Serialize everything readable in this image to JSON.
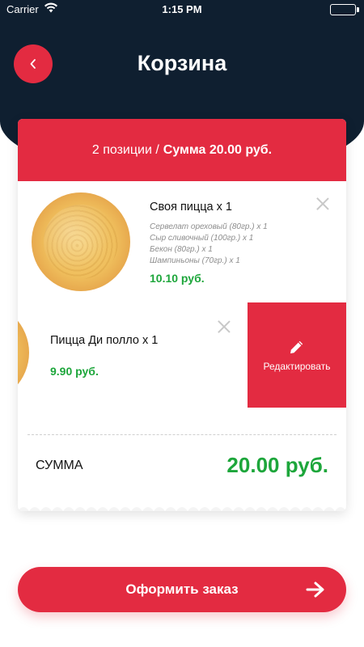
{
  "status_bar": {
    "carrier": "Carrier",
    "time": "1:15 PM",
    "battery_level": 1.0,
    "battery_color": "#2ecc40"
  },
  "header": {
    "title": "Корзина",
    "back_icon": "chevron-left-icon",
    "background_color": "#0f1f30"
  },
  "cart": {
    "summary_count": "2 позиции /",
    "summary_total": "Сумма 20.00 руб.",
    "items": [
      {
        "name": "Своя пицца x 1",
        "ingredients": [
          "Сервелат ореховый (80гр.) x 1",
          "Сыр сливочный (100гр.) x 1",
          "Бекон (80гр.) x 1",
          "Шампиньоны (70гр.) x 1"
        ],
        "price": "10.10 руб."
      },
      {
        "name": "Пицца Ди полло x 1",
        "price": "9.90 руб.",
        "edit_label": "Редактировать"
      }
    ],
    "total_label": "СУММА",
    "total_value": "20.00 руб."
  },
  "order_button": {
    "label": "Оформить заказ",
    "icon": "arrow-right-icon"
  },
  "colors": {
    "accent": "#e32b41",
    "price_green": "#1da63b"
  }
}
